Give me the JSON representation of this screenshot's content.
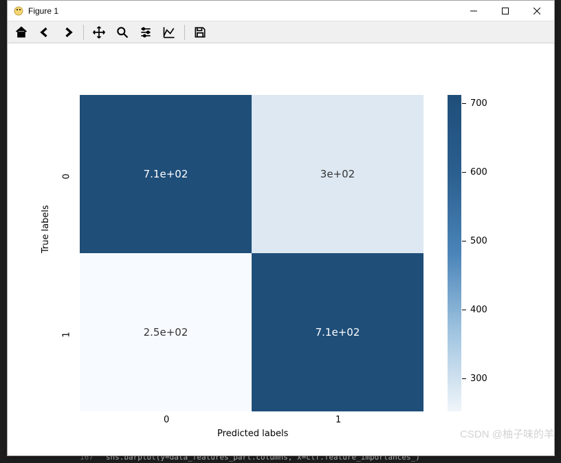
{
  "window": {
    "title": "Figure 1"
  },
  "toolbar": {
    "home": "home-icon",
    "back": "back-icon",
    "forward": "forward-icon",
    "pan": "pan-icon",
    "zoom": "zoom-icon",
    "config": "config-icon",
    "axes": "axes-icon",
    "save": "save-icon"
  },
  "chart_data": {
    "type": "heatmap",
    "title": "",
    "xlabel": "Predicted labels",
    "ylabel": "True labels",
    "x_categories": [
      "0",
      "1"
    ],
    "y_categories": [
      "0",
      "1"
    ],
    "matrix": [
      [
        710,
        300
      ],
      [
        250,
        710
      ]
    ],
    "cell_labels": [
      [
        "7.1e+02",
        "3e+02"
      ],
      [
        "2.5e+02",
        "7.1e+02"
      ]
    ],
    "colorbar": {
      "ticks": [
        700,
        600,
        500,
        400,
        300
      ],
      "range": [
        250,
        710
      ]
    },
    "colors": {
      "high": "#1f4e79",
      "mid1": "#dde8f2",
      "mid2": "#f7fbff"
    }
  },
  "watermark": "CSDN @柚子味的羊",
  "background_code": {
    "line_no": "167",
    "text": "sns.barplot(y=data_features_part.columns, x=clf.feature_importances_)"
  }
}
